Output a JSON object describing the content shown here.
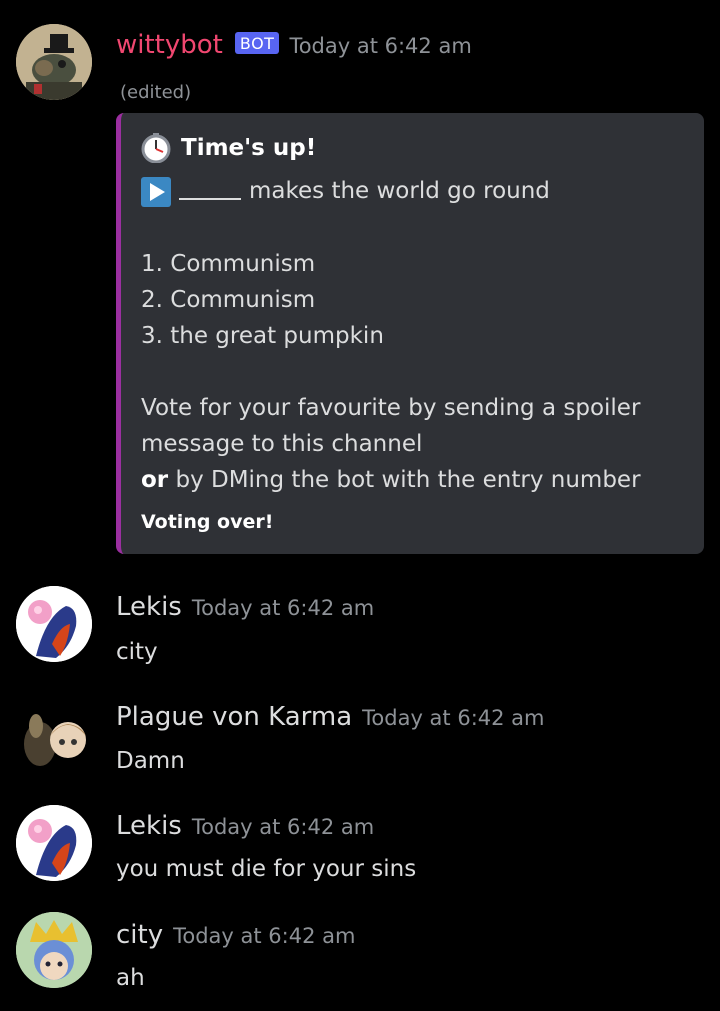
{
  "messages": [
    {
      "author": "wittybot",
      "author_color": "#f04770",
      "badge": "BOT",
      "timestamp": "Today at 6:42 am",
      "edited": "(edited)",
      "embed": {
        "title": "Time's up!",
        "prompt": "makes the world go round",
        "entries": [
          "1. Communism",
          "2. Communism",
          "3. the great pumpkin"
        ],
        "vote_line1": "Vote for your favourite by sending a spoiler",
        "vote_line2": "message to this channel",
        "vote_or": "or",
        "vote_line3_rest": " by DMing the bot with the entry number",
        "footer": "Voting over!",
        "accent_color": "#9b2fa0"
      }
    },
    {
      "author": "Lekis",
      "author_color": "#dcddde",
      "timestamp": "Today at 6:42 am",
      "text": "city"
    },
    {
      "author": "Plague von Karma",
      "author_color": "#dcddde",
      "timestamp": "Today at 6:42 am",
      "text": "Damn"
    },
    {
      "author": "Lekis",
      "author_color": "#dcddde",
      "timestamp": "Today at 6:42 am",
      "text": "you must die for your sins"
    },
    {
      "author": "city",
      "author_color": "#dcddde",
      "timestamp": "Today at 6:42 am",
      "text": "ah"
    }
  ]
}
